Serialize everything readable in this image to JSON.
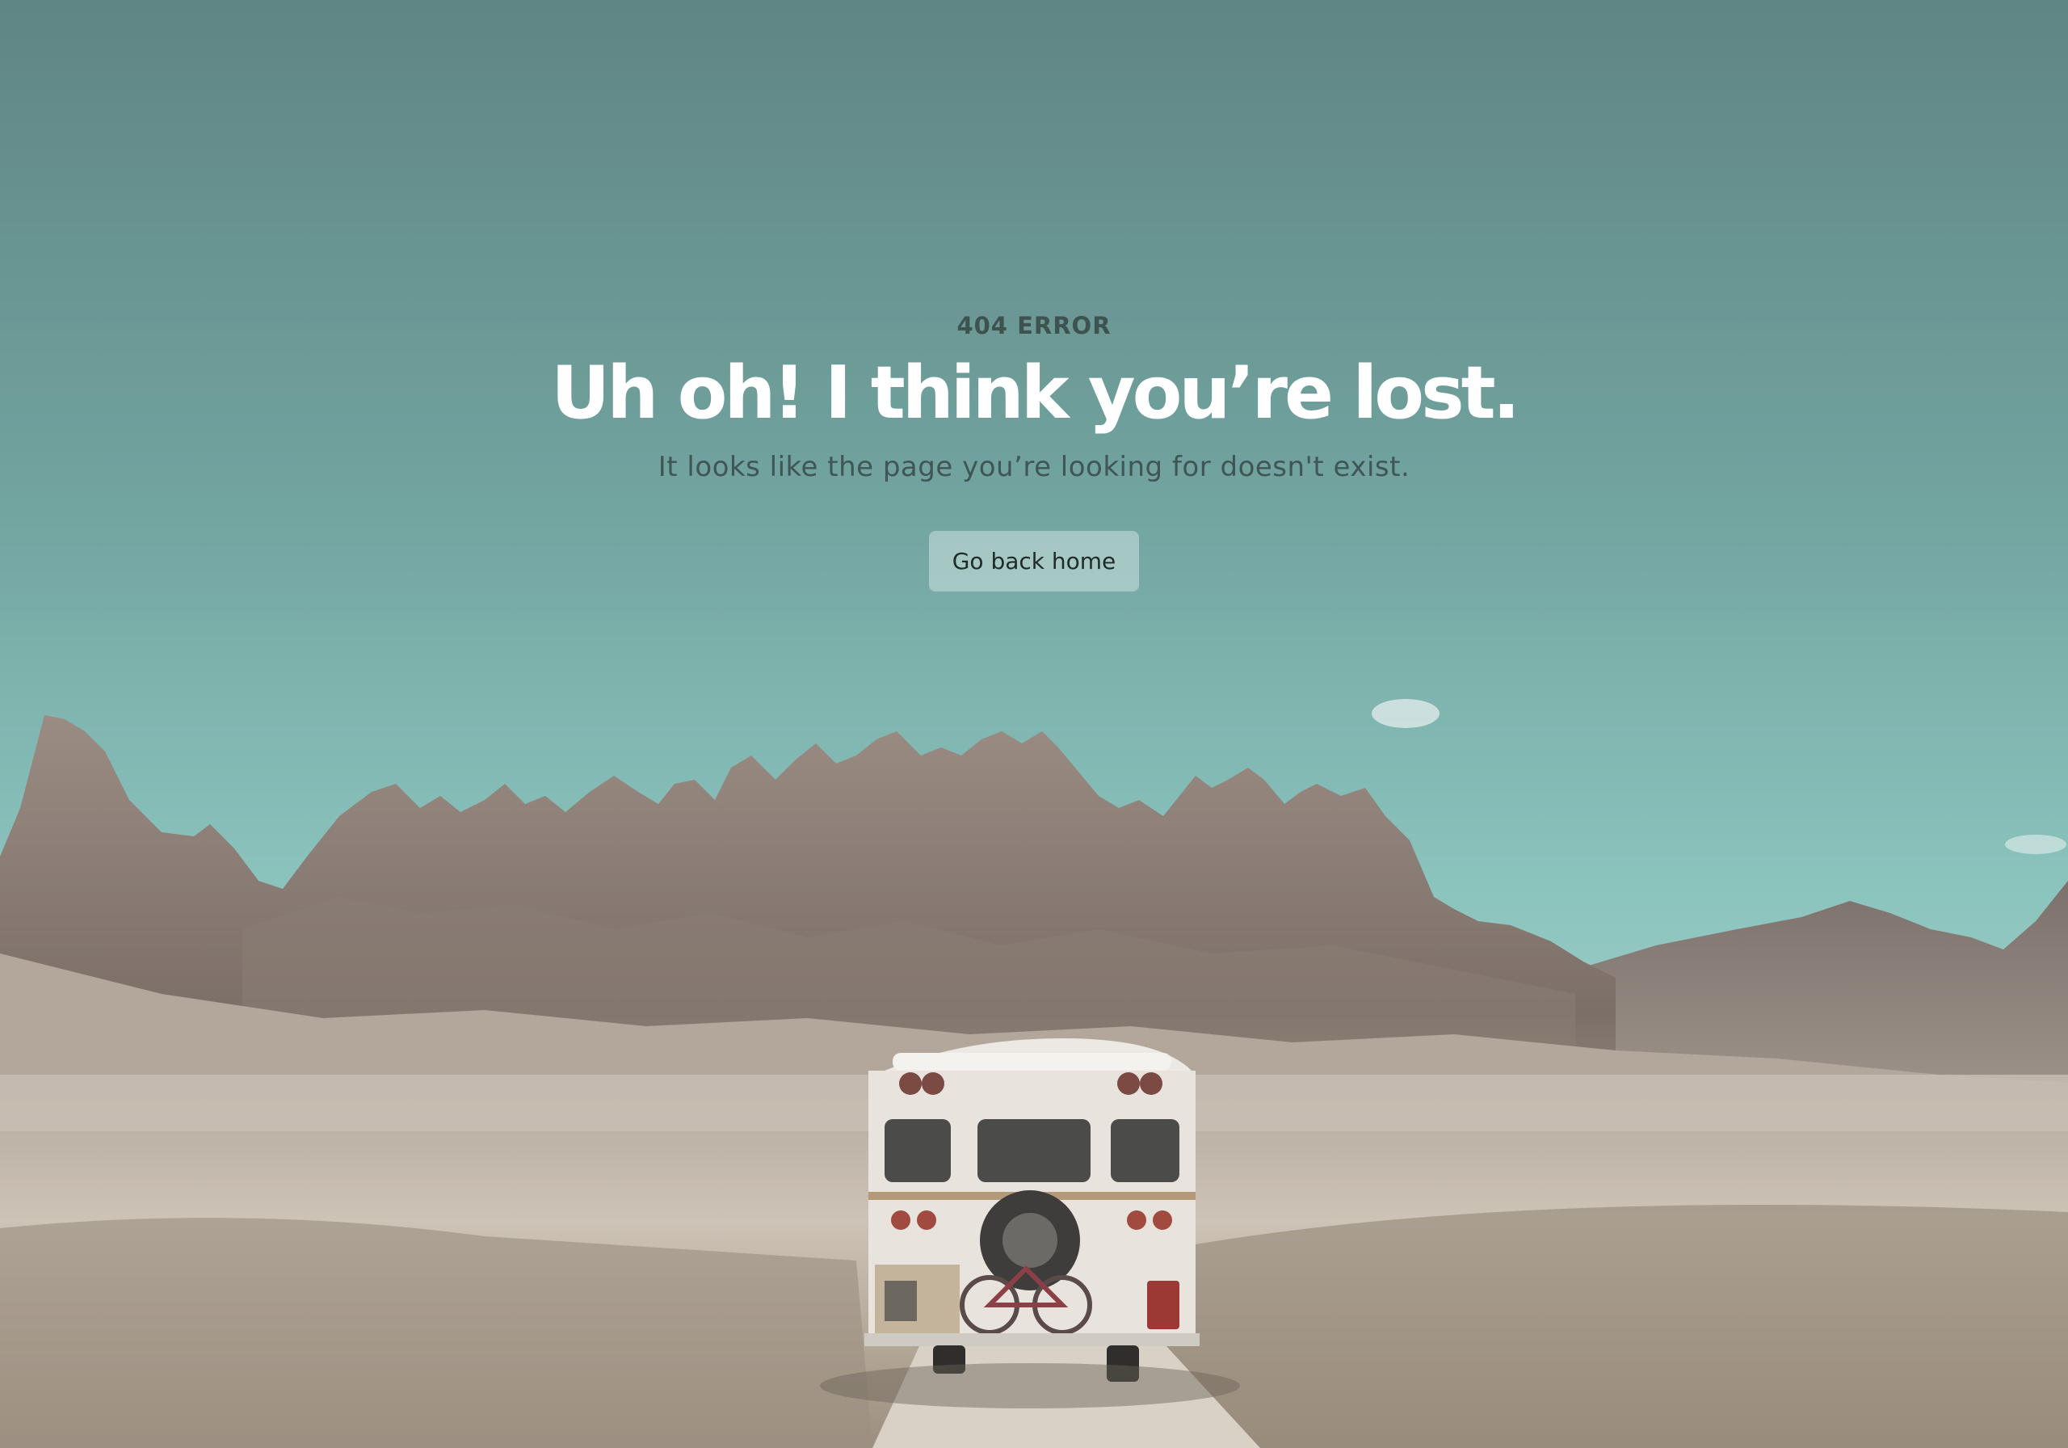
{
  "error": {
    "code_label": "404 ERROR",
    "headline": "Uh oh! I think you’re lost.",
    "message": "It looks like the page you’re looking for doesn't exist.",
    "home_button_label": "Go back home"
  },
  "background": {
    "scene": "desert-mountains-with-bus",
    "sky_top_color": "#62898a",
    "sky_mid_color": "#7fb5b0",
    "sky_horizon_color": "#bfdcd8",
    "mountain_color": "#8e8178",
    "ground_color": "#c9bfb2"
  }
}
